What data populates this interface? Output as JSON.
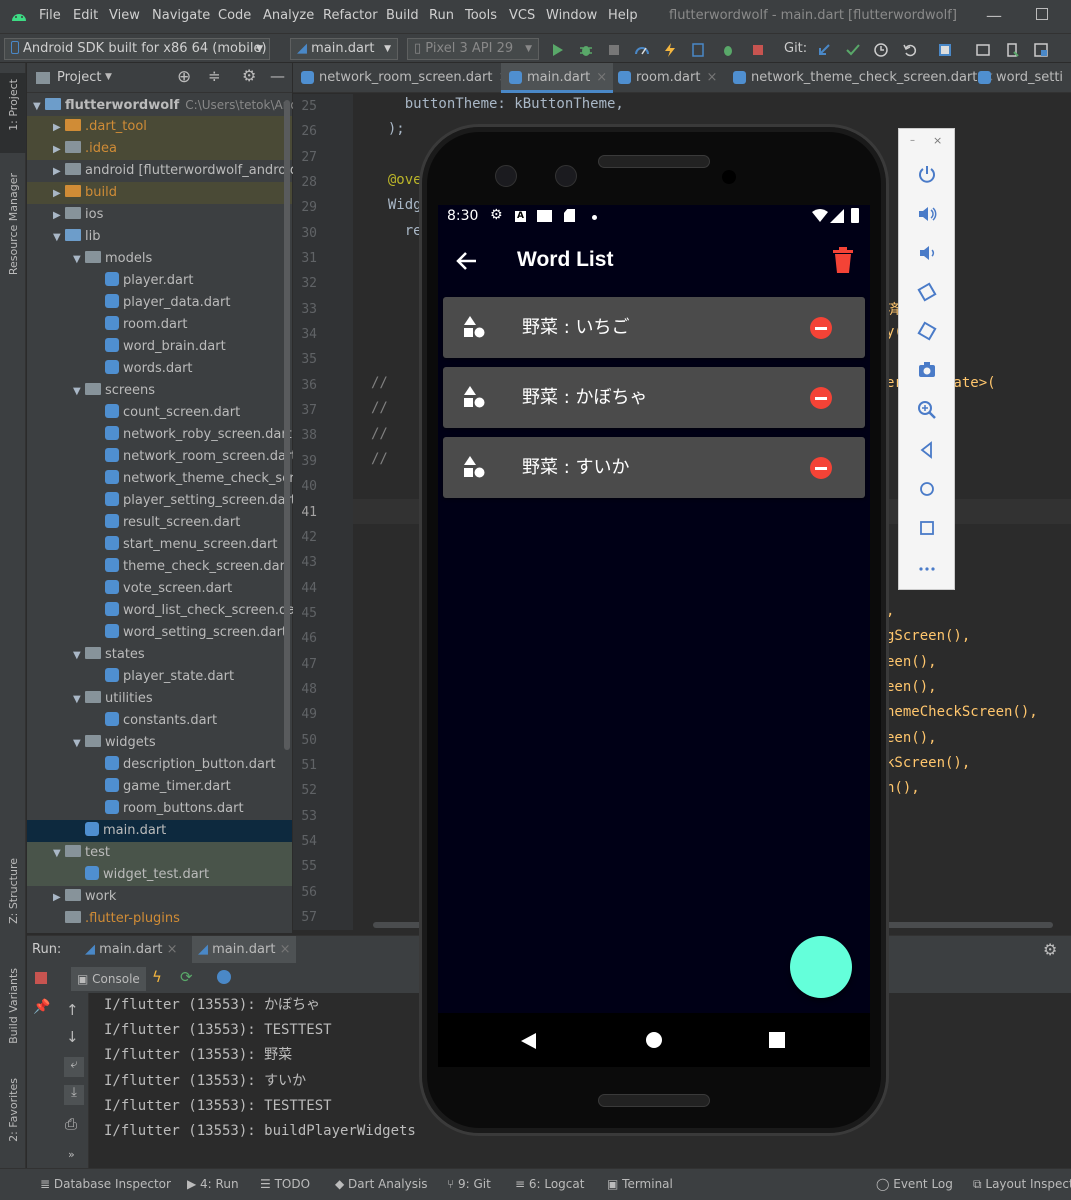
{
  "ide": {
    "window_title": "flutterwordwolf - main.dart [flutterwordwolf]",
    "menu": [
      "File",
      "Edit",
      "View",
      "Navigate",
      "Code",
      "Analyze",
      "Refactor",
      "Build",
      "Run",
      "Tools",
      "VCS",
      "Window",
      "Help"
    ],
    "toolbar": {
      "device": "Android SDK built for x86 64 (mobile)",
      "run_config": "main.dart",
      "avd": "Pixel 3 API 29",
      "git_label": "Git:"
    },
    "left_stripe": [
      "1: Project",
      "Resource Manager",
      "Z: Structure",
      "Build Variants",
      "2: Favorites"
    ],
    "project_panel": {
      "title": "Project",
      "root": "flutterwordwolf",
      "root_path": "C:\\Users\\tetok\\Andro",
      "tree": [
        {
          "label": "flutterwordwolf",
          "indent": 0,
          "arrow": "▼",
          "icon": "folder-blue",
          "bold": true
        },
        {
          "label": ".dart_tool",
          "indent": 1,
          "arrow": "▶",
          "icon": "folder-orange",
          "color": "#d08c36"
        },
        {
          "label": ".idea",
          "indent": 1,
          "arrow": "▶",
          "icon": "folder",
          "color": "#d08c36"
        },
        {
          "label": "android [flutterwordwolf_android]",
          "indent": 1,
          "arrow": "▶",
          "icon": "folder"
        },
        {
          "label": "build",
          "indent": 1,
          "arrow": "▶",
          "icon": "folder-orange",
          "color": "#d08c36"
        },
        {
          "label": "ios",
          "indent": 1,
          "arrow": "▶",
          "icon": "folder"
        },
        {
          "label": "lib",
          "indent": 1,
          "arrow": "▼",
          "icon": "folder-blue"
        },
        {
          "label": "models",
          "indent": 2,
          "arrow": "▼",
          "icon": "folder"
        },
        {
          "label": "player.dart",
          "indent": 3,
          "arrow": "",
          "icon": "dart"
        },
        {
          "label": "player_data.dart",
          "indent": 3,
          "arrow": "",
          "icon": "dart"
        },
        {
          "label": "room.dart",
          "indent": 3,
          "arrow": "",
          "icon": "dart"
        },
        {
          "label": "word_brain.dart",
          "indent": 3,
          "arrow": "",
          "icon": "dart"
        },
        {
          "label": "words.dart",
          "indent": 3,
          "arrow": "",
          "icon": "dart"
        },
        {
          "label": "screens",
          "indent": 2,
          "arrow": "▼",
          "icon": "folder"
        },
        {
          "label": "count_screen.dart",
          "indent": 3,
          "arrow": "",
          "icon": "dart"
        },
        {
          "label": "network_roby_screen.dart",
          "indent": 3,
          "arrow": "",
          "icon": "dart"
        },
        {
          "label": "network_room_screen.dart",
          "indent": 3,
          "arrow": "",
          "icon": "dart"
        },
        {
          "label": "network_theme_check_screen.dart",
          "indent": 3,
          "arrow": "",
          "icon": "dart"
        },
        {
          "label": "player_setting_screen.dart",
          "indent": 3,
          "arrow": "",
          "icon": "dart"
        },
        {
          "label": "result_screen.dart",
          "indent": 3,
          "arrow": "",
          "icon": "dart"
        },
        {
          "label": "start_menu_screen.dart",
          "indent": 3,
          "arrow": "",
          "icon": "dart"
        },
        {
          "label": "theme_check_screen.dart",
          "indent": 3,
          "arrow": "",
          "icon": "dart"
        },
        {
          "label": "vote_screen.dart",
          "indent": 3,
          "arrow": "",
          "icon": "dart"
        },
        {
          "label": "word_list_check_screen.dart",
          "indent": 3,
          "arrow": "",
          "icon": "dart"
        },
        {
          "label": "word_setting_screen.dart",
          "indent": 3,
          "arrow": "",
          "icon": "dart"
        },
        {
          "label": "states",
          "indent": 2,
          "arrow": "▼",
          "icon": "folder"
        },
        {
          "label": "player_state.dart",
          "indent": 3,
          "arrow": "",
          "icon": "dart"
        },
        {
          "label": "utilities",
          "indent": 2,
          "arrow": "▼",
          "icon": "folder"
        },
        {
          "label": "constants.dart",
          "indent": 3,
          "arrow": "",
          "icon": "dart"
        },
        {
          "label": "widgets",
          "indent": 2,
          "arrow": "▼",
          "icon": "folder"
        },
        {
          "label": "description_button.dart",
          "indent": 3,
          "arrow": "",
          "icon": "dart"
        },
        {
          "label": "game_timer.dart",
          "indent": 3,
          "arrow": "",
          "icon": "dart"
        },
        {
          "label": "room_buttons.dart",
          "indent": 3,
          "arrow": "",
          "icon": "dart"
        },
        {
          "label": "main.dart",
          "indent": 2,
          "arrow": "",
          "icon": "dart",
          "selected": true
        },
        {
          "label": "test",
          "indent": 1,
          "arrow": "▼",
          "icon": "folder",
          "test": true
        },
        {
          "label": "widget_test.dart",
          "indent": 2,
          "arrow": "",
          "icon": "dart",
          "test": true
        },
        {
          "label": "work",
          "indent": 1,
          "arrow": "▶",
          "icon": "folder"
        },
        {
          "label": ".flutter-plugins",
          "indent": 1,
          "arrow": "",
          "icon": "file",
          "color": "#d08c36"
        }
      ]
    },
    "editor_tabs": [
      "network_room_screen.dart",
      "main.dart",
      "room.dart",
      "network_theme_check_screen.dart",
      "word_setti"
    ],
    "active_tab": "main.dart",
    "line_numbers": [
      "25",
      "26",
      "27",
      "28",
      "29",
      "30",
      "31",
      "32",
      "33",
      "34",
      "35",
      "36",
      "37",
      "38",
      "39",
      "40",
      "41",
      "42",
      "43",
      "44",
      "45",
      "46",
      "47",
      "48",
      "49",
      "50",
      "51",
      "52",
      "53",
      "54",
      "55",
      "56",
      "57"
    ],
    "current_line": "41",
    "code_visible": [
      {
        "line": "25",
        "text": "    buttonTheme: kButtonTheme,"
      },
      {
        "line": "26",
        "text": "  );"
      },
      {
        "line": "28",
        "text": "  @ove"
      },
      {
        "line": "29",
        "text": "  Widg"
      },
      {
        "line": "30",
        "text": "    re"
      },
      {
        "line": "36",
        "text": "//"
      },
      {
        "line": "37",
        "text": "//"
      },
      {
        "line": "38",
        "text": "//"
      },
      {
        "line": "39",
        "text": "//"
      }
    ],
    "code_right_fragments": [
      {
        "line": "33",
        "text": "済 "
      },
      {
        "line": "34",
        "text": "y(),"
      },
      {
        "line": "36",
        "text": "erDataState>("
      },
      {
        "line": "45",
        "text": ","
      },
      {
        "line": "46",
        "text": "gScreen(),"
      },
      {
        "line": "47",
        "text": "een(),"
      },
      {
        "line": "48",
        "text": "een(),"
      },
      {
        "line": "49",
        "text": "hemeCheckScreen(),"
      },
      {
        "line": "50",
        "text": "een(),"
      },
      {
        "line": "51",
        "text": "kScreen(),"
      },
      {
        "line": "52",
        "text": "n(),"
      }
    ],
    "run_panel": {
      "label": "Run:",
      "tabs": [
        "main.dart",
        "main.dart"
      ],
      "console_label": "Console",
      "log": [
        "I/flutter (13553): かぼちゃ",
        "I/flutter (13553): TESTTEST",
        "I/flutter (13553): 野菜",
        "I/flutter (13553): すいか",
        "I/flutter (13553): TESTTEST",
        "I/flutter (13553): buildPlayerWidgets"
      ]
    },
    "statusbar": [
      "Database Inspector",
      "4: Run",
      "TODO",
      "Dart Analysis",
      "9: Git",
      "6: Logcat",
      "Terminal",
      "Event Log",
      "Layout Inspect"
    ]
  },
  "phone": {
    "time": "8:30",
    "app_title": "Word List",
    "words": [
      "野菜 : いちご",
      "野菜 : かぼちゃ",
      "野菜 : すいか"
    ],
    "colors": {
      "background": "#000016",
      "card": "#4b4b4b",
      "delete_red": "#f44336",
      "fab": "#64ffda"
    }
  },
  "emulator_controls": [
    "power-icon",
    "volume-up-icon",
    "volume-down-icon",
    "rotate-left-icon",
    "rotate-right-icon",
    "camera-icon",
    "zoom-icon",
    "back-icon",
    "home-icon",
    "overview-icon",
    "more-icon"
  ]
}
